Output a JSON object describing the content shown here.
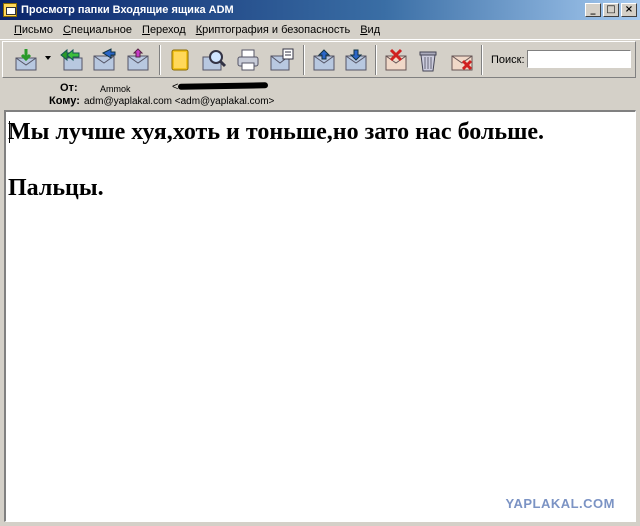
{
  "window": {
    "title": "Просмотр папки Входящие ящика ADM",
    "minimize": "_",
    "maximize": "□",
    "close": "×"
  },
  "menu": [
    {
      "label": "Письмо",
      "accel": "П",
      "rest": "исьмо"
    },
    {
      "label": "Специальное",
      "accel": "С",
      "rest": "пециальное"
    },
    {
      "label": "Переход",
      "accel": "П",
      "rest": "ереход"
    },
    {
      "label": "Криптография и безопасность",
      "accel": "К",
      "rest": "риптография и безопасность"
    },
    {
      "label": "Вид",
      "accel": "В",
      "rest": "ид"
    }
  ],
  "toolbar": {
    "icons": [
      "get-mail-icon",
      "reply-all-icon",
      "forward-icon",
      "send-icon",
      "address-book-icon",
      "find-icon",
      "print-icon",
      "properties-icon",
      "previous-icon",
      "next-icon",
      "delete-icon",
      "trash-icon",
      "flag-icon"
    ],
    "search_label": "Поиск:",
    "search_value": ""
  },
  "header": {
    "from_label": "От:",
    "from_name": "Ammok",
    "from_addr_open": "<",
    "to_label": "Кому:",
    "to_value": "adm@yaplakal.com <adm@yaplakal.com>"
  },
  "message": {
    "line1": "Мы лучше хуя,хоть и тоньше,но зато нас больше.",
    "line2": "Пальцы."
  },
  "watermark": "YAPLAKAL.COM"
}
